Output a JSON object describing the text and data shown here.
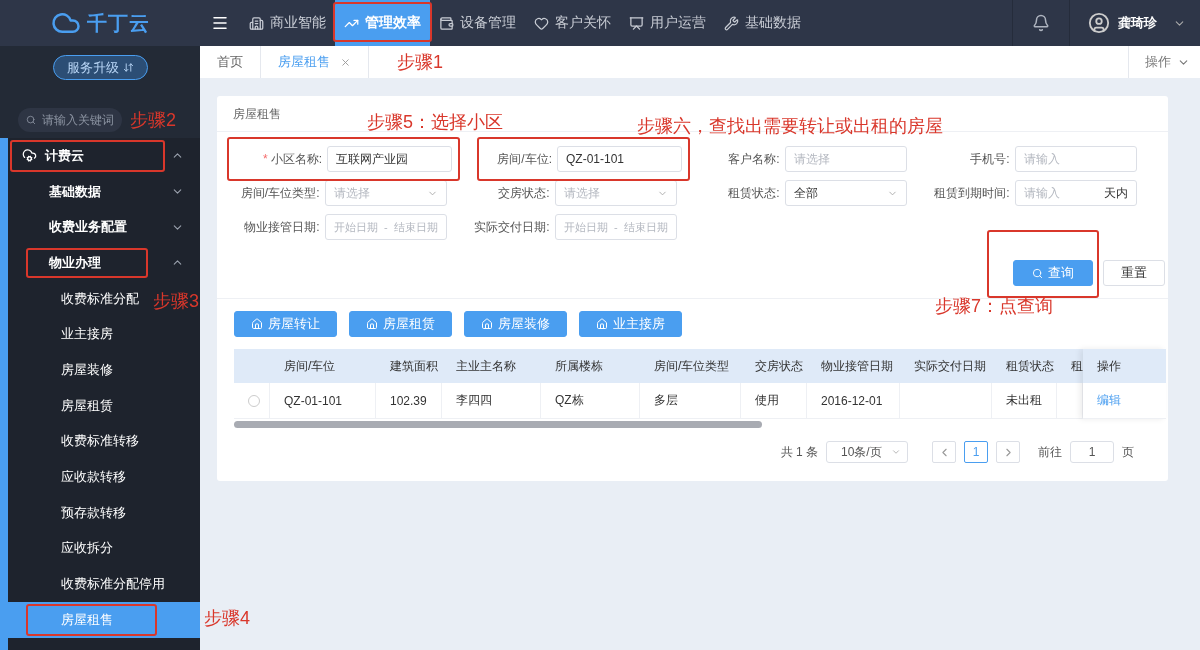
{
  "brand": {
    "name": "千丁云"
  },
  "upgrade_button": "服务升级",
  "top_nav": [
    {
      "label": "商业智能",
      "selected": false
    },
    {
      "label": "管理效率",
      "selected": true,
      "callout": {
        "text": "步骤1"
      }
    },
    {
      "label": "设备管理",
      "selected": false
    },
    {
      "label": "客户关怀",
      "selected": false
    },
    {
      "label": "用户运营",
      "selected": false
    },
    {
      "label": "基础数据",
      "selected": false
    }
  ],
  "user": {
    "name": "龚琦珍"
  },
  "sidebar": {
    "search_placeholder": "请输入关键词",
    "items": [
      {
        "label": "计费云",
        "expanded": true,
        "callout": {
          "text": "步骤2"
        },
        "children": [
          {
            "label": "基础数据",
            "expanded": false
          },
          {
            "label": "收费业务配置",
            "expanded": false
          },
          {
            "label": "物业办理",
            "expanded": true,
            "callout": {
              "text": "步骤3"
            },
            "children": [
              {
                "label": "收费标准分配",
                "selected": false
              },
              {
                "label": "业主接房",
                "selected": false
              },
              {
                "label": "房屋装修",
                "selected": false
              },
              {
                "label": "房屋租赁",
                "selected": false
              },
              {
                "label": "收费标准转移",
                "selected": false
              },
              {
                "label": "应收款转移",
                "selected": false
              },
              {
                "label": "预存款转移",
                "selected": false
              },
              {
                "label": "应收拆分",
                "selected": false
              },
              {
                "label": "收费标准分配停用",
                "selected": false
              },
              {
                "label": "房屋租售",
                "selected": true,
                "callout": {
                  "text": "步骤4"
                }
              }
            ]
          }
        ]
      }
    ]
  },
  "tabs": [
    {
      "label": "首页",
      "selected": false,
      "closable": false
    },
    {
      "label": "房屋租售",
      "selected": true,
      "closable": true
    }
  ],
  "tabs_menu": "操作",
  "panel": {
    "title": "房屋租售",
    "filters": [
      {
        "kind": "text",
        "label": "小区名称:",
        "required_mark": "*",
        "value": "互联网产业园",
        "callout": {
          "text": "步骤5：选择小区"
        }
      },
      {
        "kind": "text",
        "label": "房间/车位:",
        "value": "QZ-01-101",
        "callout": {
          "text": "步骤六，查找出需要转让或出租的房屋"
        }
      },
      {
        "kind": "text",
        "label": "客户名称:",
        "placeholder": "请选择"
      },
      {
        "kind": "text",
        "label": "手机号:",
        "placeholder": "请输入"
      },
      {
        "kind": "select",
        "label": "房间/车位类型:",
        "placeholder": "请选择"
      },
      {
        "kind": "select",
        "label": "交房状态:",
        "placeholder": "请选择"
      },
      {
        "kind": "select",
        "label": "租赁状态:",
        "value": "全部"
      },
      {
        "kind": "suffix",
        "label": "租赁到期时间:",
        "placeholder": "请输入",
        "suffix": "天内"
      },
      {
        "kind": "daterange",
        "label": "物业接管日期:",
        "start": "开始日期",
        "separator": "-",
        "end": "结束日期"
      },
      {
        "kind": "daterange",
        "label": "实际交付日期:",
        "start": "开始日期",
        "separator": "-",
        "end": "结束日期"
      }
    ],
    "search_button": {
      "label": "查询",
      "callout": {
        "text": "步骤7：点查询"
      }
    },
    "reset_button": "重置",
    "actions": [
      "房屋转让",
      "房屋租赁",
      "房屋装修",
      "业主接房"
    ],
    "table": {
      "columns": [
        "房间/车位",
        "建筑面积",
        "主业主名称",
        "所属楼栋",
        "房间/车位类型",
        "交房状态",
        "物业接管日期",
        "实际交付日期",
        "租赁状态",
        "租"
      ],
      "action_column": "操作",
      "rows": [
        {
          "selected": false,
          "cells": [
            "QZ-01-101",
            "102.39",
            "李四四",
            "QZ栋",
            "多层",
            "使用",
            "2016-12-01",
            "",
            "未出租",
            ""
          ],
          "actions": [
            "编辑"
          ]
        }
      ]
    },
    "pagination": {
      "total": "共 1 条",
      "page_size": "10条/页",
      "pages": [
        {
          "label": "1",
          "selected": true
        }
      ],
      "goto_label": "前往",
      "goto_value": "1",
      "goto_suffix": "页"
    }
  }
}
